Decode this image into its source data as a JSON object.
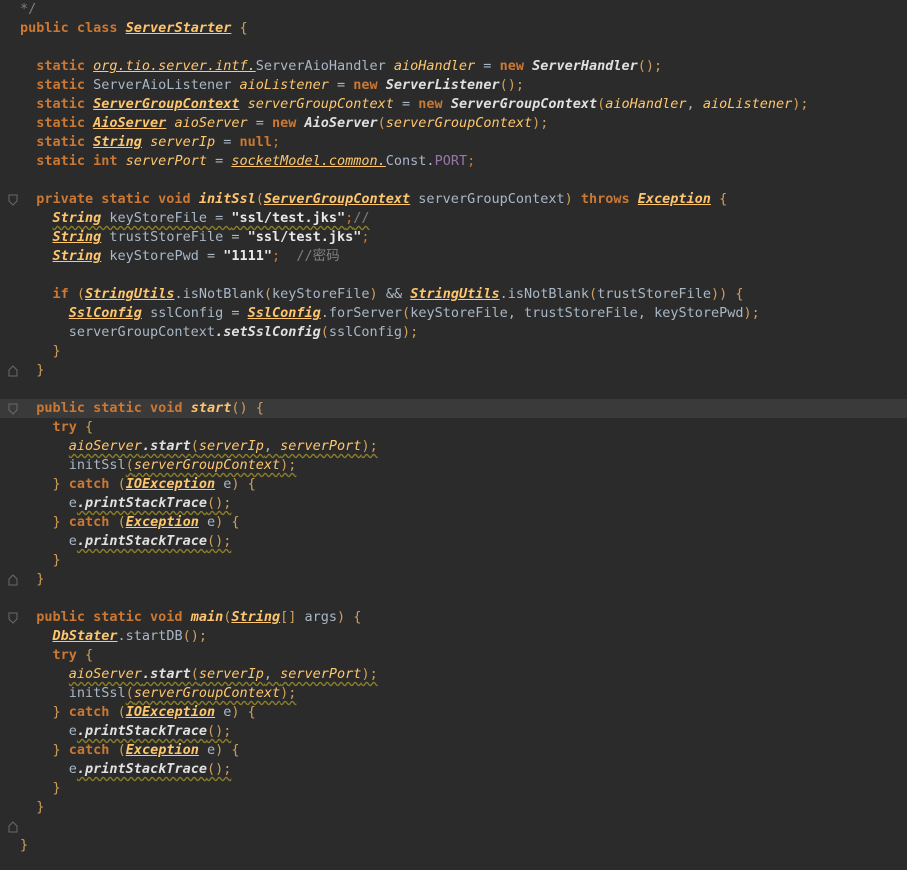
{
  "colors": {
    "background": "#2b2b2b",
    "highlight_line": "#3a3a3a",
    "keyword": "#cc7832",
    "string": "#e8e8e8",
    "comment": "#808080",
    "class_ref": "#ffc66d",
    "constant": "#9876aa"
  },
  "gutter": {
    "fold_icon": "fold-marker-icon"
  },
  "lines": [
    {
      "tokens": [
        {
          "t": "*/",
          "c": "cm"
        }
      ]
    },
    {
      "tokens": [
        {
          "t": "public class ",
          "c": "k"
        },
        {
          "t": "ServerStarter",
          "c": "cls"
        },
        {
          "t": " {",
          "c": "br"
        }
      ]
    },
    {
      "tokens": []
    },
    {
      "tokens": [
        {
          "t": "  static ",
          "c": "k"
        },
        {
          "t": "org.tio.server.intf.",
          "c": "pkg"
        },
        {
          "t": "ServerAioHandler ",
          "c": "tgray"
        },
        {
          "t": "aioHandler",
          "c": "fld"
        },
        {
          "t": " = ",
          "c": "p"
        },
        {
          "t": "new ",
          "c": "k"
        },
        {
          "t": "ServerHandler",
          "c": "sf"
        },
        {
          "t": "();",
          "c": "br"
        }
      ]
    },
    {
      "tokens": [
        {
          "t": "  static ",
          "c": "k"
        },
        {
          "t": "ServerAioListener ",
          "c": "tgray"
        },
        {
          "t": "aioListener",
          "c": "fld"
        },
        {
          "t": " = ",
          "c": "p"
        },
        {
          "t": "new ",
          "c": "k"
        },
        {
          "t": "ServerListener",
          "c": "sf"
        },
        {
          "t": "();",
          "c": "br"
        }
      ]
    },
    {
      "tokens": [
        {
          "t": "  static ",
          "c": "k"
        },
        {
          "t": "ServerGroupContext",
          "c": "cls"
        },
        {
          "t": " serverGroupContext",
          "c": "fld"
        },
        {
          "t": " = ",
          "c": "p"
        },
        {
          "t": "new ",
          "c": "k"
        },
        {
          "t": "ServerGroupContext",
          "c": "sf"
        },
        {
          "t": "(",
          "c": "br"
        },
        {
          "t": "aioHandler",
          "c": "fld"
        },
        {
          "t": ", ",
          "c": "p"
        },
        {
          "t": "aioListener",
          "c": "fld"
        },
        {
          "t": ");",
          "c": "br"
        }
      ]
    },
    {
      "tokens": [
        {
          "t": "  static ",
          "c": "k"
        },
        {
          "t": "AioServer",
          "c": "cls"
        },
        {
          "t": " aioServer",
          "c": "fld"
        },
        {
          "t": " = ",
          "c": "p"
        },
        {
          "t": "new ",
          "c": "k"
        },
        {
          "t": "AioServer",
          "c": "sf"
        },
        {
          "t": "(",
          "c": "br"
        },
        {
          "t": "serverGroupContext",
          "c": "fld"
        },
        {
          "t": ");",
          "c": "br"
        }
      ]
    },
    {
      "tokens": [
        {
          "t": "  static ",
          "c": "k"
        },
        {
          "t": "String",
          "c": "cls"
        },
        {
          "t": " serverIp",
          "c": "fld"
        },
        {
          "t": " = ",
          "c": "p"
        },
        {
          "t": "null",
          "c": "k"
        },
        {
          "t": ";",
          "c": "cs"
        }
      ]
    },
    {
      "tokens": [
        {
          "t": "  static int ",
          "c": "k"
        },
        {
          "t": "serverPort",
          "c": "fld"
        },
        {
          "t": " = ",
          "c": "p"
        },
        {
          "t": "socketModel.common.",
          "c": "pkg"
        },
        {
          "t": "Const.",
          "c": "tgray"
        },
        {
          "t": "PORT",
          "c": "pu"
        },
        {
          "t": ";",
          "c": "cs"
        }
      ]
    },
    {
      "tokens": []
    },
    {
      "fold": true,
      "tokens": [
        {
          "t": "  private static void ",
          "c": "k"
        },
        {
          "t": "initSsl",
          "c": "fn"
        },
        {
          "t": "(",
          "c": "br"
        },
        {
          "t": "ServerGroupContext",
          "c": "cls"
        },
        {
          "t": " serverGroupContext",
          "c": "v"
        },
        {
          "t": ") ",
          "c": "br"
        },
        {
          "t": "throws ",
          "c": "k"
        },
        {
          "t": "Exception",
          "c": "cls"
        },
        {
          "t": " {",
          "c": "br"
        }
      ]
    },
    {
      "wavy": true,
      "tokens": [
        {
          "t": "    ",
          "c": "p"
        },
        {
          "t": "String",
          "c": "cls"
        },
        {
          "t": " keyStoreFile",
          "c": "v"
        },
        {
          "t": " = ",
          "c": "p"
        },
        {
          "t": "\"ssl/test.jks\"",
          "c": "s"
        },
        {
          "t": ";",
          "c": "cs"
        },
        {
          "t": "//",
          "c": "cm"
        }
      ]
    },
    {
      "tokens": [
        {
          "t": "    ",
          "c": "p"
        },
        {
          "t": "String",
          "c": "cls"
        },
        {
          "t": " trustStoreFile",
          "c": "v"
        },
        {
          "t": " = ",
          "c": "p"
        },
        {
          "t": "\"ssl/test.jks\"",
          "c": "s"
        },
        {
          "t": ";",
          "c": "cs"
        }
      ]
    },
    {
      "tokens": [
        {
          "t": "    ",
          "c": "p"
        },
        {
          "t": "String",
          "c": "cls"
        },
        {
          "t": " keyStorePwd",
          "c": "v"
        },
        {
          "t": " = ",
          "c": "p"
        },
        {
          "t": "\"1111\"",
          "c": "s"
        },
        {
          "t": ";  ",
          "c": "cs"
        },
        {
          "t": "//密码",
          "c": "cm"
        }
      ]
    },
    {
      "tokens": []
    },
    {
      "tokens": [
        {
          "t": "    if ",
          "c": "k"
        },
        {
          "t": "(",
          "c": "br"
        },
        {
          "t": "StringUtils",
          "c": "cls"
        },
        {
          "t": ".isNotBlank",
          "c": "mg"
        },
        {
          "t": "(",
          "c": "br"
        },
        {
          "t": "keyStoreFile",
          "c": "v"
        },
        {
          "t": ") ",
          "c": "br"
        },
        {
          "t": "&& ",
          "c": "p"
        },
        {
          "t": "StringUtils",
          "c": "cls"
        },
        {
          "t": ".isNotBlank",
          "c": "mg"
        },
        {
          "t": "(",
          "c": "br"
        },
        {
          "t": "trustStoreFile",
          "c": "v"
        },
        {
          "t": ")) {",
          "c": "br"
        }
      ]
    },
    {
      "tokens": [
        {
          "t": "      ",
          "c": "p"
        },
        {
          "t": "SslConfig",
          "c": "cls"
        },
        {
          "t": " sslConfig",
          "c": "v"
        },
        {
          "t": " = ",
          "c": "p"
        },
        {
          "t": "SslConfig",
          "c": "cls"
        },
        {
          "t": ".forServer",
          "c": "mg"
        },
        {
          "t": "(",
          "c": "br"
        },
        {
          "t": "keyStoreFile",
          "c": "v"
        },
        {
          "t": ", ",
          "c": "p"
        },
        {
          "t": "trustStoreFile",
          "c": "v"
        },
        {
          "t": ", ",
          "c": "p"
        },
        {
          "t": "keyStorePwd",
          "c": "v"
        },
        {
          "t": ");",
          "c": "br"
        }
      ]
    },
    {
      "tokens": [
        {
          "t": "      serverGroupContext",
          "c": "v"
        },
        {
          "t": ".setSslConfig",
          "c": "mc"
        },
        {
          "t": "(",
          "c": "br"
        },
        {
          "t": "sslConfig",
          "c": "v"
        },
        {
          "t": ");",
          "c": "br"
        }
      ]
    },
    {
      "tokens": [
        {
          "t": "    }",
          "c": "br"
        }
      ]
    },
    {
      "tokens": [
        {
          "t": "  }",
          "c": "br"
        }
      ]
    },
    {
      "tokens": []
    },
    {
      "fold": true,
      "hl": true,
      "tokens": [
        {
          "t": "  public static void ",
          "c": "k"
        },
        {
          "t": "start",
          "c": "fn"
        },
        {
          "t": "() {",
          "c": "br"
        }
      ]
    },
    {
      "tokens": [
        {
          "t": "    try ",
          "c": "k"
        },
        {
          "t": "{",
          "c": "br"
        }
      ]
    },
    {
      "wavy": true,
      "tokens": [
        {
          "t": "      ",
          "c": "p"
        },
        {
          "t": "aioServer",
          "c": "fld"
        },
        {
          "t": ".start",
          "c": "mc"
        },
        {
          "t": "(",
          "c": "br"
        },
        {
          "t": "serverIp",
          "c": "fld"
        },
        {
          "t": ", ",
          "c": "p"
        },
        {
          "t": "serverPort",
          "c": "fld"
        },
        {
          "t": ");",
          "c": "br"
        }
      ]
    },
    {
      "wavy": true,
      "tokens": [
        {
          "t": "      initSsl",
          "c": "mg"
        },
        {
          "t": "(",
          "c": "br"
        },
        {
          "t": "serverGroupContext",
          "c": "fld"
        },
        {
          "t": ");",
          "c": "br"
        }
      ]
    },
    {
      "tokens": [
        {
          "t": "    } ",
          "c": "br"
        },
        {
          "t": "catch ",
          "c": "k"
        },
        {
          "t": "(",
          "c": "br"
        },
        {
          "t": "IOException",
          "c": "cls"
        },
        {
          "t": " e",
          "c": "v"
        },
        {
          "t": ") {",
          "c": "br"
        }
      ]
    },
    {
      "wavy": true,
      "tokens": [
        {
          "t": "      e",
          "c": "v"
        },
        {
          "t": ".printStackTrace",
          "c": "mc"
        },
        {
          "t": "();",
          "c": "br"
        }
      ]
    },
    {
      "tokens": [
        {
          "t": "    } ",
          "c": "br"
        },
        {
          "t": "catch ",
          "c": "k"
        },
        {
          "t": "(",
          "c": "br"
        },
        {
          "t": "Exception",
          "c": "cls"
        },
        {
          "t": " e",
          "c": "v"
        },
        {
          "t": ") {",
          "c": "br"
        }
      ]
    },
    {
      "wavy": true,
      "tokens": [
        {
          "t": "      e",
          "c": "v"
        },
        {
          "t": ".printStackTrace",
          "c": "mc"
        },
        {
          "t": "();",
          "c": "br"
        }
      ]
    },
    {
      "tokens": [
        {
          "t": "    }",
          "c": "br"
        }
      ]
    },
    {
      "tokens": [
        {
          "t": "  }",
          "c": "br"
        }
      ]
    },
    {
      "tokens": []
    },
    {
      "fold": true,
      "tokens": [
        {
          "t": "  public static void ",
          "c": "k"
        },
        {
          "t": "main",
          "c": "fn"
        },
        {
          "t": "(",
          "c": "br"
        },
        {
          "t": "String",
          "c": "cls"
        },
        {
          "t": "[] ",
          "c": "br"
        },
        {
          "t": "args",
          "c": "v"
        },
        {
          "t": ") {",
          "c": "br"
        }
      ]
    },
    {
      "tokens": [
        {
          "t": "    ",
          "c": "p"
        },
        {
          "t": "DbStater",
          "c": "cls"
        },
        {
          "t": ".startDB",
          "c": "mg"
        },
        {
          "t": "();",
          "c": "br"
        }
      ]
    },
    {
      "tokens": [
        {
          "t": "    try ",
          "c": "k"
        },
        {
          "t": "{",
          "c": "br"
        }
      ]
    },
    {
      "wavy": true,
      "tokens": [
        {
          "t": "      ",
          "c": "p"
        },
        {
          "t": "aioServer",
          "c": "fld"
        },
        {
          "t": ".start",
          "c": "mc"
        },
        {
          "t": "(",
          "c": "br"
        },
        {
          "t": "serverIp",
          "c": "fld"
        },
        {
          "t": ", ",
          "c": "p"
        },
        {
          "t": "serverPort",
          "c": "fld"
        },
        {
          "t": ");",
          "c": "br"
        }
      ]
    },
    {
      "wavy": true,
      "tokens": [
        {
          "t": "      initSsl",
          "c": "mg"
        },
        {
          "t": "(",
          "c": "br"
        },
        {
          "t": "serverGroupContext",
          "c": "fld"
        },
        {
          "t": ");",
          "c": "br"
        }
      ]
    },
    {
      "tokens": [
        {
          "t": "    } ",
          "c": "br"
        },
        {
          "t": "catch ",
          "c": "k"
        },
        {
          "t": "(",
          "c": "br"
        },
        {
          "t": "IOException",
          "c": "cls"
        },
        {
          "t": " e",
          "c": "v"
        },
        {
          "t": ") {",
          "c": "br"
        }
      ]
    },
    {
      "wavy": true,
      "tokens": [
        {
          "t": "      e",
          "c": "v"
        },
        {
          "t": ".printStackTrace",
          "c": "mc"
        },
        {
          "t": "();",
          "c": "br"
        }
      ]
    },
    {
      "tokens": [
        {
          "t": "    } ",
          "c": "br"
        },
        {
          "t": "catch ",
          "c": "k"
        },
        {
          "t": "(",
          "c": "br"
        },
        {
          "t": "Exception",
          "c": "cls"
        },
        {
          "t": " e",
          "c": "v"
        },
        {
          "t": ") {",
          "c": "br"
        }
      ]
    },
    {
      "wavy": true,
      "tokens": [
        {
          "t": "      e",
          "c": "v"
        },
        {
          "t": ".printStackTrace",
          "c": "mc"
        },
        {
          "t": "();",
          "c": "br"
        }
      ]
    },
    {
      "tokens": [
        {
          "t": "    }",
          "c": "br"
        }
      ]
    },
    {
      "tokens": [
        {
          "t": "  }",
          "c": "br"
        }
      ]
    },
    {
      "tokens": []
    },
    {
      "tokens": [
        {
          "t": "}",
          "c": "br"
        }
      ]
    }
  ]
}
